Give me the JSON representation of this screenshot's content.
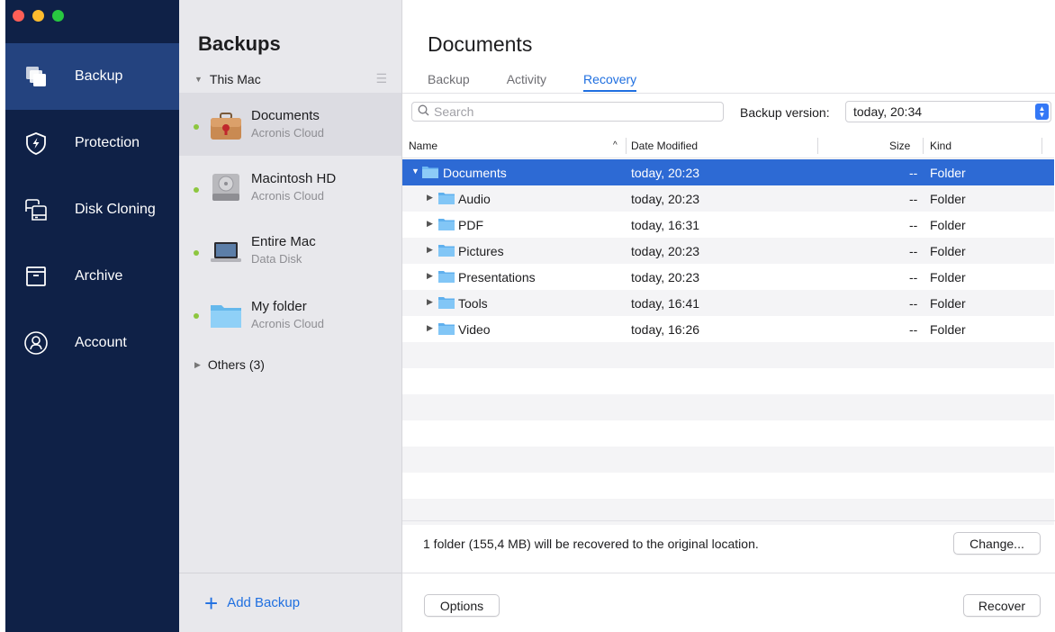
{
  "nav": {
    "items": [
      {
        "label": "Backup",
        "icon": "backup-icon"
      },
      {
        "label": "Protection",
        "icon": "shield-icon"
      },
      {
        "label": "Disk Cloning",
        "icon": "disk-cloning-icon"
      },
      {
        "label": "Archive",
        "icon": "archive-icon"
      },
      {
        "label": "Account",
        "icon": "account-icon"
      }
    ],
    "active_index": 0
  },
  "backups": {
    "title": "Backups",
    "group_label": "This Mac",
    "items": [
      {
        "name": "Documents",
        "location": "Acronis Cloud",
        "icon": "briefcase-icon"
      },
      {
        "name": "Macintosh HD",
        "location": "Acronis Cloud",
        "icon": "hard-drive-icon"
      },
      {
        "name": "Entire Mac",
        "location": "Data Disk",
        "icon": "laptop-icon"
      },
      {
        "name": "My folder",
        "location": "Acronis Cloud",
        "icon": "folder-icon"
      }
    ],
    "selected_index": 0,
    "others_label": "Others (3)",
    "add_label": "Add Backup"
  },
  "detail": {
    "title": "Documents",
    "tabs": [
      "Backup",
      "Activity",
      "Recovery"
    ],
    "active_tab": 2,
    "search_placeholder": "Search",
    "backup_version_label": "Backup version:",
    "backup_version_value": "today, 20:34",
    "columns": {
      "name": "Name",
      "date": "Date Modified",
      "size": "Size",
      "kind": "Kind"
    },
    "rows": [
      {
        "name": "Documents",
        "date": "today, 20:23",
        "size": "--",
        "kind": "Folder"
      },
      {
        "name": "Audio",
        "date": "today, 20:23",
        "size": "--",
        "kind": "Folder"
      },
      {
        "name": "PDF",
        "date": "today, 16:31",
        "size": "--",
        "kind": "Folder"
      },
      {
        "name": "Pictures",
        "date": "today, 20:23",
        "size": "--",
        "kind": "Folder"
      },
      {
        "name": "Presentations",
        "date": "today, 20:23",
        "size": "--",
        "kind": "Folder"
      },
      {
        "name": "Tools",
        "date": "today, 16:41",
        "size": "--",
        "kind": "Folder"
      },
      {
        "name": "Video",
        "date": "today, 16:26",
        "size": "--",
        "kind": "Folder"
      }
    ],
    "info_text": "1 folder (155,4 MB) will be recovered to the original location.",
    "change_label": "Change...",
    "options_label": "Options",
    "recover_label": "Recover"
  },
  "colors": {
    "nav_bg": "#0f2147",
    "nav_active": "#24437f",
    "accent": "#1f6fe0",
    "selection": "#2d6ad4",
    "status_dot": "#8dc63f"
  }
}
